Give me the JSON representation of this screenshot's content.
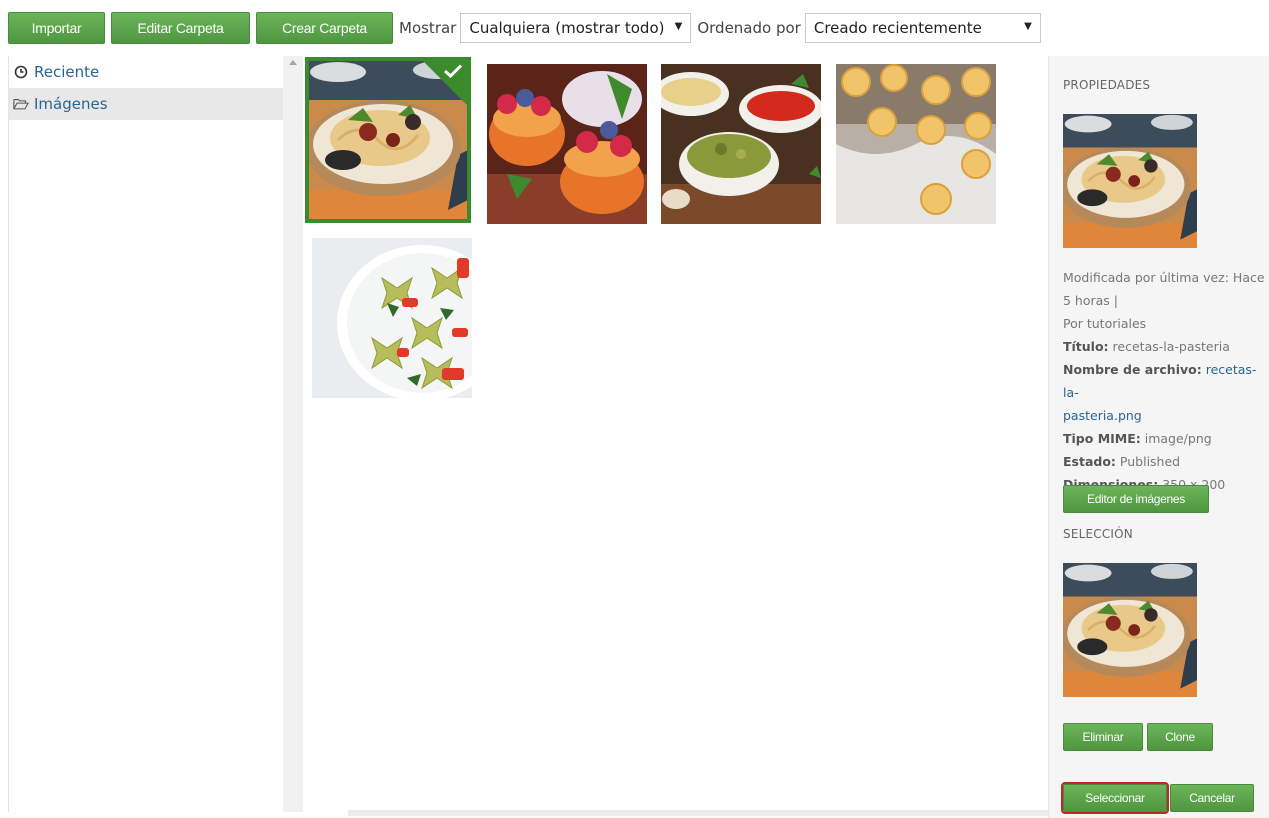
{
  "toolbar": {
    "import_label": "Importar",
    "edit_folder_label": "Editar Carpeta",
    "create_folder_label": "Crear Carpeta",
    "show_label": "Mostrar",
    "show_value": "Cualquiera (mostrar todo)",
    "sort_label": "Ordenado por",
    "sort_value": "Creado recientemente"
  },
  "tree": {
    "items": [
      {
        "label": "Reciente",
        "icon": "clock-icon"
      },
      {
        "label": "Imágenes",
        "icon": "folder-open-icon"
      }
    ]
  },
  "grid": {
    "images": [
      {
        "subject": "pasta-plate",
        "selected": true
      },
      {
        "subject": "berry-tarts",
        "selected": false
      },
      {
        "subject": "sauces-bowls",
        "selected": false
      },
      {
        "subject": "tortellini-flour",
        "selected": false
      },
      {
        "subject": "farfalle-salad",
        "selected": false
      }
    ]
  },
  "panel": {
    "properties_heading": "PROPIEDADES",
    "modified_line1": "Modificada por última vez: Hace",
    "modified_line2": "5 horas |",
    "by_line": "Por tutoriales",
    "title_label": "Título:",
    "title_value": "recetas-la-pasteria",
    "filename_label": "Nombre de archivo:",
    "filename_value1": "recetas-la-",
    "filename_value2": "pasteria.png",
    "mime_label": "Tipo MIME:",
    "mime_value": "image/png",
    "status_label": "Estado:",
    "status_value": "Published",
    "dimensions_label": "Dimensiones:",
    "dimensions_value": "350 x 200",
    "image_editor_label": "Editor de imágenes",
    "selection_heading": "SELECCIÓN",
    "remove_label": "Eliminar",
    "clone_label": "Clone",
    "select_label": "Seleccionar",
    "cancel_label": "Cancelar"
  },
  "colors": {
    "accent_green": "#5aa14a",
    "selection_green": "#3b8a2c",
    "link_blue": "#2a6592",
    "focus_red": "#c0262a"
  }
}
